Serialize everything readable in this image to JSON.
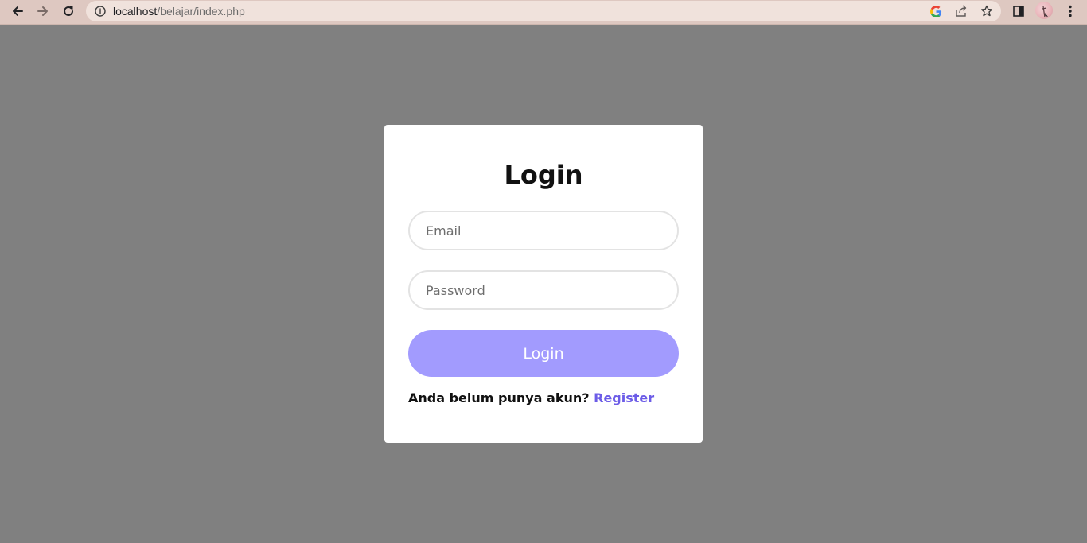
{
  "browser": {
    "url_host": "localhost",
    "url_path": "/belajar/index.php",
    "icons": [
      "back-arrow-icon",
      "forward-arrow-icon",
      "reload-icon",
      "info-icon",
      "google-icon",
      "share-icon",
      "star-icon",
      "side-panel-icon",
      "avatar",
      "kebab-menu-icon"
    ]
  },
  "login": {
    "title": "Login",
    "email_placeholder": "Email",
    "password_placeholder": "Password",
    "submit_label": "Login",
    "register_prompt": "Anda belum punya akun?",
    "register_link": "Register"
  },
  "colors": {
    "page_background": "#808080",
    "browser_bar": "#dec8c1",
    "button": "#a29bfe",
    "link": "#6c5ce7"
  }
}
